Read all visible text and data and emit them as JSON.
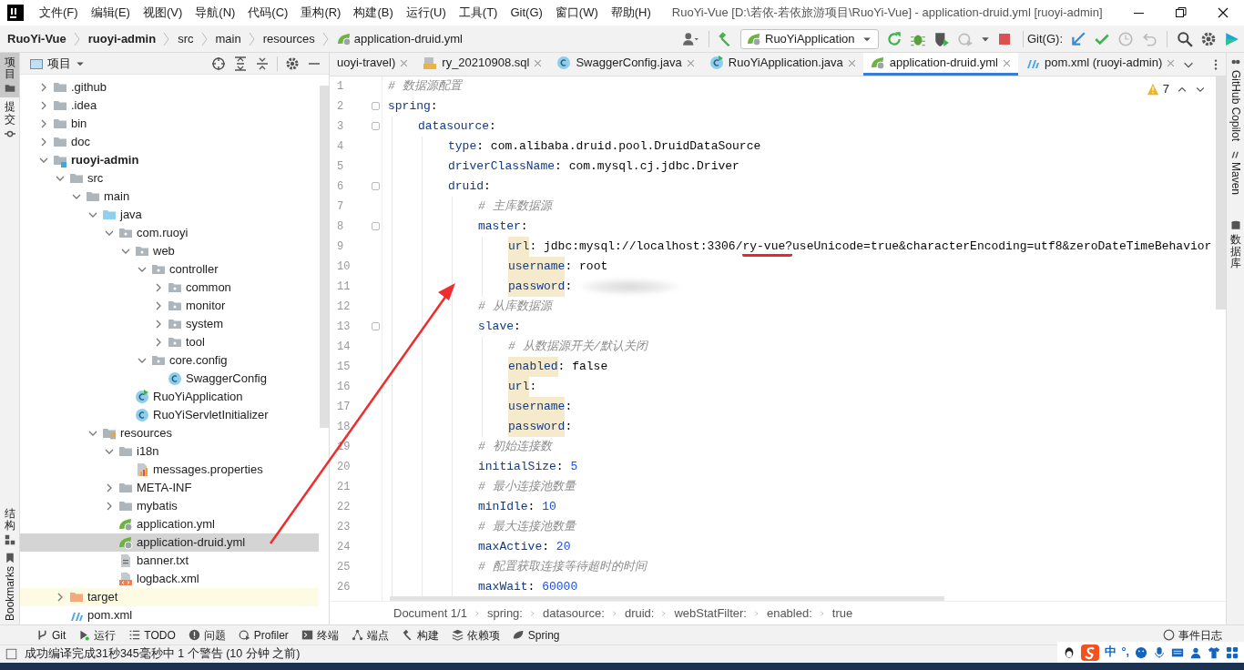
{
  "window": {
    "title": "RuoYi-Vue [D:\\若依-若依旅游项目\\RuoYi-Vue] - application-druid.yml [ruoyi-admin]"
  },
  "menu": [
    "文件(F)",
    "编辑(E)",
    "视图(V)",
    "导航(N)",
    "代码(C)",
    "重构(R)",
    "构建(B)",
    "运行(U)",
    "工具(T)",
    "Git(G)",
    "窗口(W)",
    "帮助(H)"
  ],
  "breadcrumb": [
    {
      "label": "RuoYi-Vue",
      "kind": "project"
    },
    {
      "label": "ruoyi-admin",
      "kind": "project"
    },
    {
      "label": "src",
      "kind": "folder"
    },
    {
      "label": "main",
      "kind": "folder"
    },
    {
      "label": "resources",
      "kind": "folder"
    },
    {
      "label": "application-druid.yml",
      "kind": "yml"
    }
  ],
  "run_config": "RuoYiApplication",
  "git_label": "Git(G):",
  "left_stripe": [
    {
      "label": "项目",
      "kind": "stacked",
      "selected": true
    },
    {
      "label": "提交",
      "kind": "stacked",
      "selected": false
    },
    {
      "label": "结构",
      "kind": "stacked",
      "selected": false
    },
    {
      "label": "Bookmarks",
      "kind": "up",
      "selected": false
    }
  ],
  "right_stripe": [
    {
      "label": "GitHub Copilot",
      "kind": "down"
    },
    {
      "label": "Maven",
      "kind": "down"
    },
    {
      "label": "数据库",
      "kind": "stacked"
    }
  ],
  "project_panel": {
    "title": "项目"
  },
  "tree": [
    {
      "label": ".github",
      "kind": "folder",
      "expanded": false,
      "selected": false
    },
    {
      "label": ".idea",
      "kind": "folder",
      "expanded": false,
      "selected": false
    },
    {
      "label": "bin",
      "kind": "folder",
      "expanded": false,
      "selected": false
    },
    {
      "label": "doc",
      "kind": "folder",
      "expanded": false,
      "selected": false
    },
    {
      "label": "ruoyi-admin",
      "kind": "module",
      "expanded": true,
      "selected": false,
      "children": [
        {
          "label": "src",
          "kind": "folder",
          "expanded": true,
          "selected": false,
          "children": [
            {
              "label": "main",
              "kind": "folder",
              "expanded": true,
              "selected": false,
              "children": [
                {
                  "label": "java",
                  "kind": "source",
                  "expanded": true,
                  "selected": false,
                  "children": [
                    {
                      "label": "com.ruoyi",
                      "kind": "package",
                      "expanded": true,
                      "selected": false,
                      "children": [
                        {
                          "label": "web",
                          "kind": "package",
                          "expanded": true,
                          "selected": false,
                          "children": [
                            {
                              "label": "controller",
                              "kind": "package",
                              "expanded": true,
                              "selected": false,
                              "children": [
                                {
                                  "label": "common",
                                  "kind": "package",
                                  "expanded": false,
                                  "selected": false
                                },
                                {
                                  "label": "monitor",
                                  "kind": "package",
                                  "expanded": false,
                                  "selected": false
                                },
                                {
                                  "label": "system",
                                  "kind": "package",
                                  "expanded": false,
                                  "selected": false
                                },
                                {
                                  "label": "tool",
                                  "kind": "package",
                                  "expanded": false,
                                  "selected": false
                                }
                              ]
                            },
                            {
                              "label": "core.config",
                              "kind": "package",
                              "expanded": true,
                              "selected": false,
                              "children": [
                                {
                                  "label": "SwaggerConfig",
                                  "kind": "class",
                                  "selected": false
                                }
                              ]
                            }
                          ]
                        },
                        {
                          "label": "RuoYiApplication",
                          "kind": "main-class",
                          "selected": false
                        },
                        {
                          "label": "RuoYiServletInitializer",
                          "kind": "class",
                          "selected": false
                        }
                      ]
                    }
                  ]
                },
                {
                  "label": "resources",
                  "kind": "resources",
                  "expanded": true,
                  "selected": false,
                  "children": [
                    {
                      "label": "i18n",
                      "kind": "folder",
                      "expanded": true,
                      "selected": false,
                      "children": [
                        {
                          "label": "messages.properties",
                          "kind": "properties",
                          "selected": false
                        }
                      ]
                    },
                    {
                      "label": "META-INF",
                      "kind": "folder",
                      "expanded": false,
                      "selected": false
                    },
                    {
                      "label": "mybatis",
                      "kind": "folder",
                      "expanded": false,
                      "selected": false
                    },
                    {
                      "label": "application.yml",
                      "kind": "yml",
                      "selected": false
                    },
                    {
                      "label": "application-druid.yml",
                      "kind": "yml",
                      "selected": true
                    },
                    {
                      "label": "banner.txt",
                      "kind": "text",
                      "selected": false
                    },
                    {
                      "label": "logback.xml",
                      "kind": "xml",
                      "selected": false
                    }
                  ]
                }
              ]
            }
          ]
        },
        {
          "label": "target",
          "kind": "excluded",
          "expanded": false,
          "selected": false
        },
        {
          "label": "pom.xml",
          "kind": "maven",
          "selected": false
        }
      ]
    }
  ],
  "editor_tabs": [
    {
      "label": "uoyi-travel)",
      "selected": false
    },
    {
      "label": "ry_20210908.sql",
      "kind": "sql",
      "selected": false
    },
    {
      "label": "SwaggerConfig.java",
      "kind": "class",
      "selected": false
    },
    {
      "label": "RuoYiApplication.java",
      "kind": "main-class",
      "selected": false
    },
    {
      "label": "application-druid.yml",
      "kind": "yml",
      "selected": true
    },
    {
      "label": "pom.xml (ruoyi-admin)",
      "kind": "maven",
      "selected": false
    }
  ],
  "inspections": {
    "warnings": "7"
  },
  "code": [
    {
      "num": "1",
      "tokens": [
        {
          "kind": "comment",
          "text": "# 数据源配置"
        }
      ]
    },
    {
      "num": "2",
      "tokens": [
        {
          "kind": "key",
          "text": "spring",
          "highlighted": false
        },
        {
          "kind": "punct",
          "text": ":"
        }
      ],
      "children": [
        {
          "num": "3",
          "tokens": [
            {
              "kind": "key",
              "text": "datasource",
              "highlighted": false
            },
            {
              "kind": "punct",
              "text": ":"
            }
          ],
          "children": [
            {
              "num": "4",
              "tokens": [
                {
                  "kind": "key",
                  "text": "type",
                  "highlighted": false
                },
                {
                  "kind": "punct",
                  "text": ": "
                },
                {
                  "kind": "string",
                  "text": "com.alibaba.druid.pool.DruidDataSource"
                }
              ]
            },
            {
              "num": "5",
              "tokens": [
                {
                  "kind": "key",
                  "text": "driverClassName",
                  "highlighted": false
                },
                {
                  "kind": "punct",
                  "text": ": "
                },
                {
                  "kind": "string",
                  "text": "com.mysql.cj.jdbc.Driver"
                }
              ]
            },
            {
              "num": "6",
              "tokens": [
                {
                  "kind": "key",
                  "text": "druid",
                  "highlighted": false
                },
                {
                  "kind": "punct",
                  "text": ":"
                }
              ],
              "children": [
                {
                  "num": "7",
                  "tokens": [
                    {
                      "kind": "comment",
                      "text": "# 主库数据源"
                    }
                  ]
                },
                {
                  "num": "8",
                  "tokens": [
                    {
                      "kind": "key",
                      "text": "master",
                      "highlighted": false
                    },
                    {
                      "kind": "punct",
                      "text": ":"
                    }
                  ],
                  "children": [
                    {
                      "num": "9",
                      "tokens": [
                        {
                          "kind": "key",
                          "text": "url",
                          "highlighted": true
                        },
                        {
                          "kind": "punct",
                          "text": ": "
                        },
                        {
                          "kind": "string",
                          "text": "jdbc:mysql://localhost:3306/"
                        },
                        {
                          "kind": "string",
                          "text": "ry-vue?",
                          "underlined": true
                        },
                        {
                          "kind": "string",
                          "text": "useUnicode=true&characterEncoding=utf8&zeroDateTimeBehavior"
                        }
                      ]
                    },
                    {
                      "num": "10",
                      "tokens": [
                        {
                          "kind": "key",
                          "text": "username",
                          "highlighted": true
                        },
                        {
                          "kind": "punct",
                          "text": ": "
                        },
                        {
                          "kind": "string",
                          "text": "root"
                        }
                      ]
                    },
                    {
                      "num": "11",
                      "tokens": [
                        {
                          "kind": "key",
                          "text": "password",
                          "highlighted": true
                        },
                        {
                          "kind": "punct",
                          "text": ": "
                        },
                        {
                          "kind": "blurred"
                        }
                      ]
                    }
                  ]
                },
                {
                  "num": "12",
                  "tokens": [
                    {
                      "kind": "comment",
                      "text": "# 从库数据源"
                    }
                  ]
                },
                {
                  "num": "13",
                  "tokens": [
                    {
                      "kind": "key",
                      "text": "slave",
                      "highlighted": false
                    },
                    {
                      "kind": "punct",
                      "text": ":"
                    }
                  ],
                  "children": [
                    {
                      "num": "14",
                      "tokens": [
                        {
                          "kind": "comment",
                          "text": "# 从数据源开关/默认关闭"
                        }
                      ]
                    },
                    {
                      "num": "15",
                      "tokens": [
                        {
                          "kind": "key",
                          "text": "enabled",
                          "highlighted": true
                        },
                        {
                          "kind": "punct",
                          "text": ": "
                        },
                        {
                          "kind": "string",
                          "text": "false"
                        }
                      ]
                    },
                    {
                      "num": "16",
                      "tokens": [
                        {
                          "kind": "key",
                          "text": "url",
                          "highlighted": true
                        },
                        {
                          "kind": "punct",
                          "text": ":"
                        }
                      ]
                    },
                    {
                      "num": "17",
                      "tokens": [
                        {
                          "kind": "key",
                          "text": "username",
                          "highlighted": true
                        },
                        {
                          "kind": "punct",
                          "text": ":"
                        }
                      ]
                    },
                    {
                      "num": "18",
                      "tokens": [
                        {
                          "kind": "key",
                          "text": "password",
                          "highlighted": true
                        },
                        {
                          "kind": "punct",
                          "text": ":"
                        }
                      ]
                    }
                  ]
                },
                {
                  "num": "19",
                  "tokens": [
                    {
                      "kind": "comment",
                      "text": "# 初始连接数"
                    }
                  ]
                },
                {
                  "num": "20",
                  "tokens": [
                    {
                      "kind": "key",
                      "text": "initialSize",
                      "highlighted": false
                    },
                    {
                      "kind": "punct",
                      "text": ": "
                    },
                    {
                      "kind": "number",
                      "text": "5"
                    }
                  ]
                },
                {
                  "num": "21",
                  "tokens": [
                    {
                      "kind": "comment",
                      "text": "# 最小连接池数量"
                    }
                  ]
                },
                {
                  "num": "22",
                  "tokens": [
                    {
                      "kind": "key",
                      "text": "minIdle",
                      "highlighted": false
                    },
                    {
                      "kind": "punct",
                      "text": ": "
                    },
                    {
                      "kind": "number",
                      "text": "10"
                    }
                  ]
                },
                {
                  "num": "23",
                  "tokens": [
                    {
                      "kind": "comment",
                      "text": "# 最大连接池数量"
                    }
                  ]
                },
                {
                  "num": "24",
                  "tokens": [
                    {
                      "kind": "key",
                      "text": "maxActive",
                      "highlighted": false
                    },
                    {
                      "kind": "punct",
                      "text": ": "
                    },
                    {
                      "kind": "number",
                      "text": "20"
                    }
                  ]
                },
                {
                  "num": "25",
                  "tokens": [
                    {
                      "kind": "comment",
                      "text": "# 配置获取连接等待超时的时间"
                    }
                  ]
                },
                {
                  "num": "26",
                  "tokens": [
                    {
                      "kind": "key",
                      "text": "maxWait",
                      "highlighted": false
                    },
                    {
                      "kind": "punct",
                      "text": ": "
                    },
                    {
                      "kind": "number",
                      "text": "60000"
                    }
                  ]
                }
              ]
            }
          ]
        }
      ]
    }
  ],
  "editor_breadcrumb": [
    "Document 1/1",
    "spring:",
    "datasource:",
    "druid:",
    "webStatFilter:",
    "enabled:",
    "true"
  ],
  "tool_windows": [
    {
      "label": "Git",
      "kind": "git"
    },
    {
      "label": "运行",
      "kind": "run"
    },
    {
      "label": "TODO",
      "kind": "todo"
    },
    {
      "label": "问题",
      "kind": "problems"
    },
    {
      "label": "Profiler",
      "kind": "profiler"
    },
    {
      "label": "终端",
      "kind": "terminal"
    },
    {
      "label": "端点",
      "kind": "endpoints"
    },
    {
      "label": "构建",
      "kind": "build"
    },
    {
      "label": "依赖项",
      "kind": "dependencies"
    },
    {
      "label": "Spring",
      "kind": "spring"
    }
  ],
  "event_log": "事件日志",
  "status": "成功编译完成31秒345毫秒中 1 个警告 (10 分钟 之前)",
  "tray": [
    "中",
    "°,"
  ]
}
